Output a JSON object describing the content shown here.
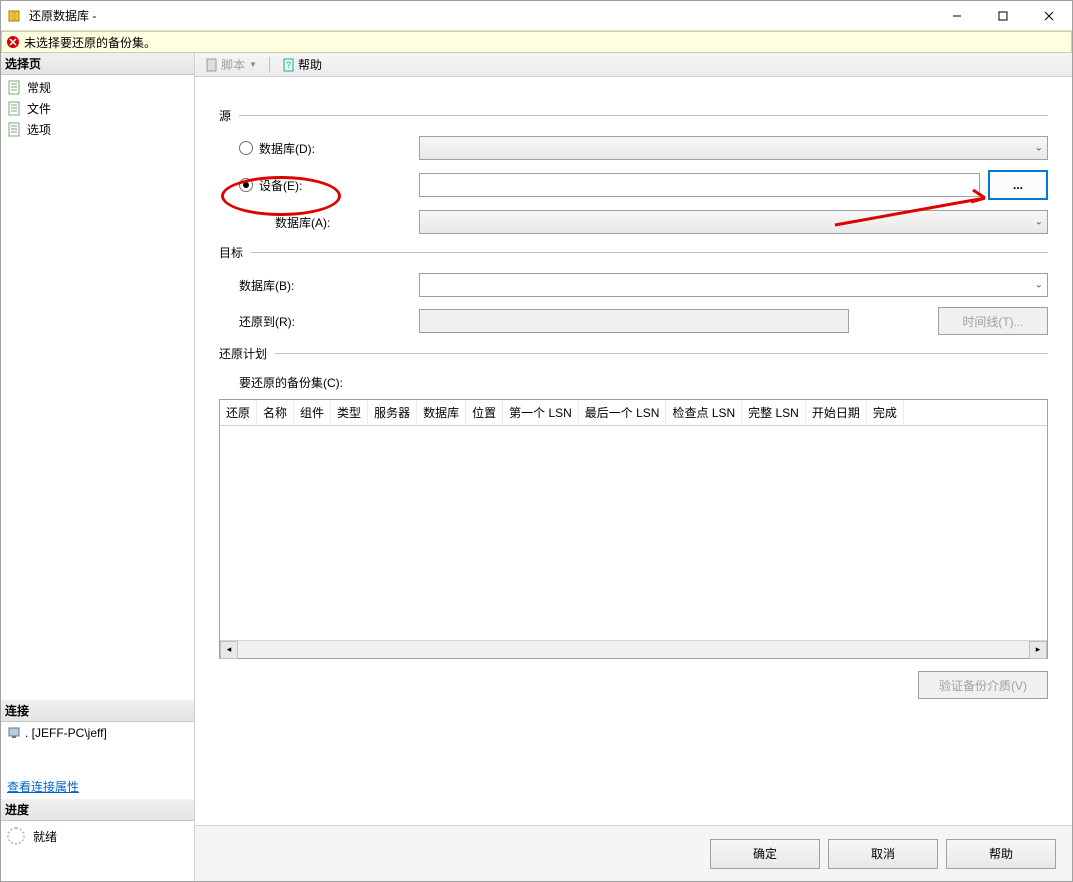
{
  "window": {
    "title": "还原数据库 -"
  },
  "warning": {
    "text": "未选择要还原的备份集。"
  },
  "left": {
    "select_page_header": "选择页",
    "nav": {
      "general": "常规",
      "files": "文件",
      "options": "选项"
    },
    "connection_header": "连接",
    "connection_value": ". [JEFF-PC\\jeff]",
    "view_conn_props": "查看连接属性",
    "progress_header": "进度",
    "progress_status": "就绪"
  },
  "toolbar": {
    "script": "脚本",
    "help": "帮助"
  },
  "form": {
    "source_header": "源",
    "database_radio": "数据库(D):",
    "device_radio": "设备(E):",
    "device_db_label": "数据库(A):",
    "browse_ellipsis": "...",
    "target_header": "目标",
    "target_db_label": "数据库(B):",
    "restore_to_label": "还原到(R):",
    "timeline_btn": "时间线(T)...",
    "plan_header": "还原计划",
    "backup_sets_label": "要还原的备份集(C):",
    "verify_btn": "验证备份介质(V)"
  },
  "table": {
    "cols": [
      "还原",
      "名称",
      "组件",
      "类型",
      "服务器",
      "数据库",
      "位置",
      "第一个 LSN",
      "最后一个 LSN",
      "检查点 LSN",
      "完整 LSN",
      "开始日期",
      "完成"
    ]
  },
  "footer": {
    "ok": "确定",
    "cancel": "取消",
    "help": "帮助"
  }
}
